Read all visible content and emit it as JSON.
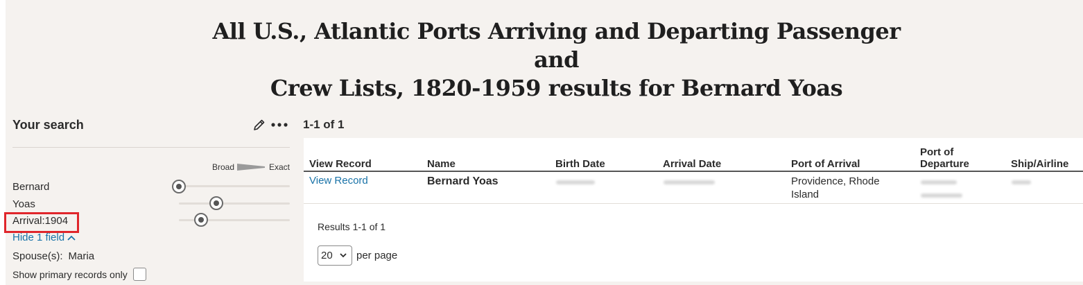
{
  "page": {
    "title_line1": "All U.S., Atlantic Ports Arriving and Departing Passenger and",
    "title_line2": "Crew Lists, 1820-1959 results for Bernard Yoas"
  },
  "sidebar": {
    "heading": "Your search",
    "edit_icon": "pencil-icon",
    "more_icon": "ellipsis-icon",
    "scale_broad": "Broad",
    "scale_exact": "Exact",
    "terms": [
      {
        "label": "Bernard",
        "exactness": 0.0
      },
      {
        "label": "Yoas",
        "exactness": 0.33
      },
      {
        "label": "Arrival:1904",
        "exactness": 0.2
      }
    ],
    "hide_fields": "Hide 1 field",
    "spouse_label": "Spouse(s):",
    "spouse_value": "Maria",
    "primary_only": "Show primary records only",
    "primary_only_checked": false
  },
  "results": {
    "count": "1-1 of 1",
    "columns": [
      "View Record",
      "Name",
      "Birth Date",
      "Arrival Date",
      "Port of Arrival",
      "Port of\nDeparture",
      "Ship/Airline"
    ],
    "columns_port_departure_line1": "Port of",
    "columns_port_departure_line2": "Departure",
    "rows": [
      {
        "view_record": "View Record",
        "name": "Bernard Yoas",
        "port_of_arrival": "Providence, Rhode Island"
      }
    ],
    "range_text": "Results 1-1 of 1",
    "per_page_value": "20",
    "per_page_label": "per page"
  },
  "colors": {
    "link": "#1a73a8",
    "highlight": "#e0262b",
    "page_bg": "#f5f2ef"
  }
}
